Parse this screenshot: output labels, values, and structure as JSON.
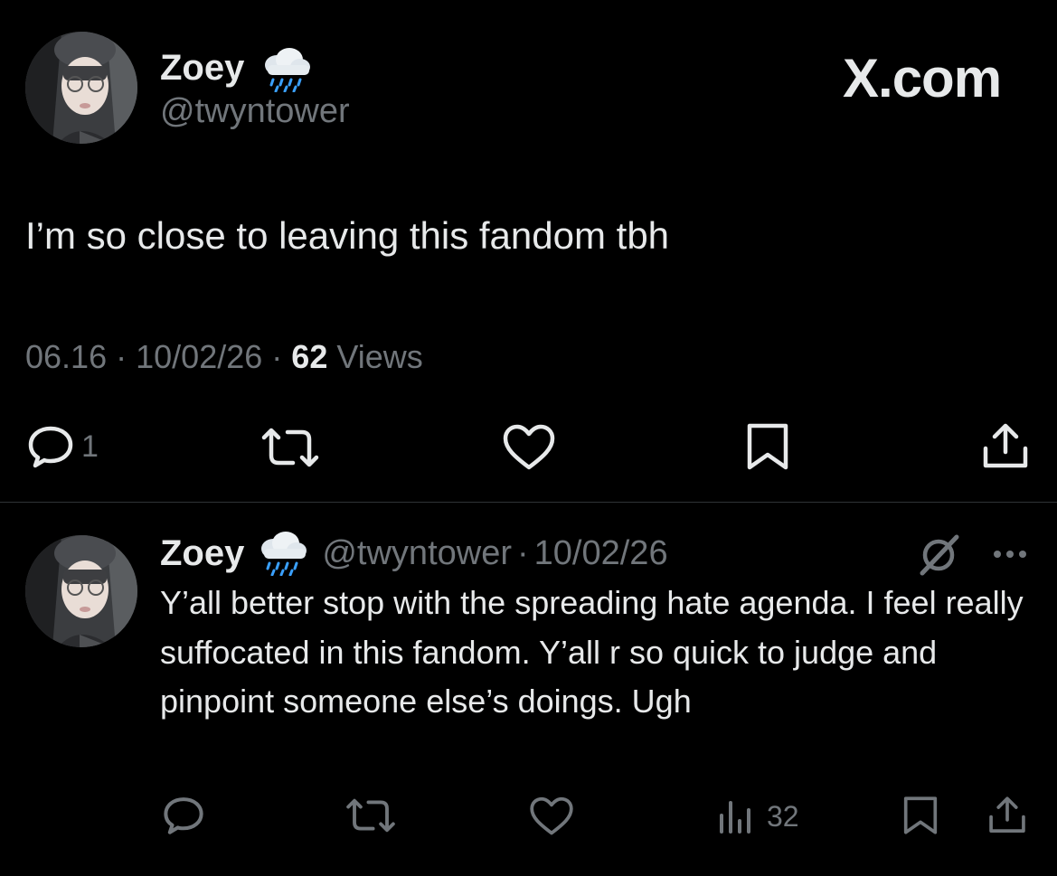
{
  "brand": {
    "label": "X.com"
  },
  "tweet": {
    "author_name": "Zoey",
    "emoji": "🌧️",
    "handle": "@twyntower",
    "text": "I’m so close to leaving this fandom tbh",
    "time": "06.16",
    "sep1": "·",
    "date": "10/02/26",
    "sep2": "·",
    "views_count": "62",
    "views_label": "Views",
    "actions": {
      "reply_count": "1"
    }
  },
  "reply": {
    "author_name": "Zoey",
    "emoji": "🌧️",
    "handle": "@twyntower",
    "sep": "·",
    "date": "10/02/26",
    "text": "Y’all better stop with the spreading hate agenda. I feel really suffocated in this fandom. Y’all r so quick to judge and pinpoint someone else’s doings. Ugh",
    "actions": {
      "views_count": "32"
    }
  },
  "colors": {
    "background": "#000000",
    "text": "#e7e9ea",
    "muted": "#71767b",
    "divider": "#2f3336"
  }
}
